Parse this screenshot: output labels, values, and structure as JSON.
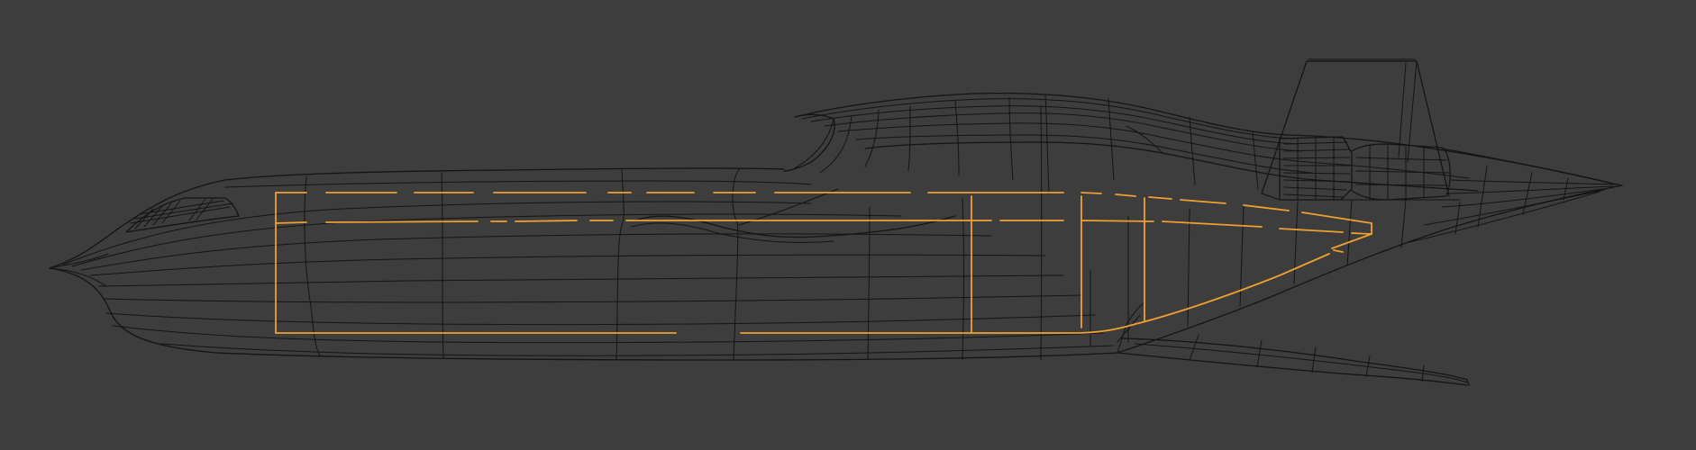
{
  "viewport": {
    "background_color": "#3d3d3d",
    "wire_color": "#141414",
    "selected_edge_color": "#f0a030"
  },
  "scene": {
    "object": "hull-wireframe",
    "view": "side-orthographic",
    "display": "wireframe",
    "selection": "edge-loop"
  }
}
